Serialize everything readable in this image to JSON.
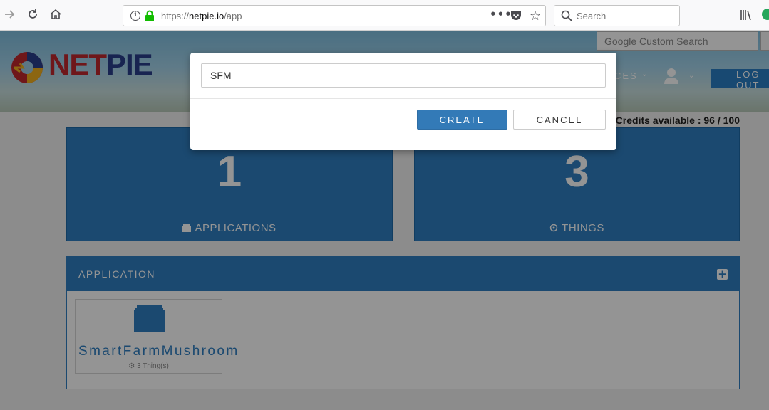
{
  "browser": {
    "url_scheme": "https://",
    "url_host": "netpie.io",
    "url_path": "/app",
    "search_placeholder": "Search"
  },
  "site": {
    "logo_text_net": "NET",
    "logo_text_pie": "PIE",
    "google_search_placeholder": "Google Custom Search",
    "menu_fragment": "CES",
    "logout_label": "LOG OUT",
    "credits": "Credits available : 96 / 100"
  },
  "stats": {
    "applications": {
      "count": "1",
      "label": "APPLICATIONS"
    },
    "things": {
      "count": "3",
      "label": "THINGS"
    }
  },
  "application_panel": {
    "title": "APPLICATION",
    "apps": [
      {
        "name": "SmartFarmMushroom",
        "things": "3 Thing(s)"
      }
    ]
  },
  "modal": {
    "input_value": "SFM",
    "create_label": "CREATE",
    "cancel_label": "CANCEL"
  },
  "colors": {
    "primary": "#2f7fc2",
    "button_primary": "#337ab7",
    "logo_red": "#c0282d",
    "logo_blue": "#2a3f8c"
  }
}
